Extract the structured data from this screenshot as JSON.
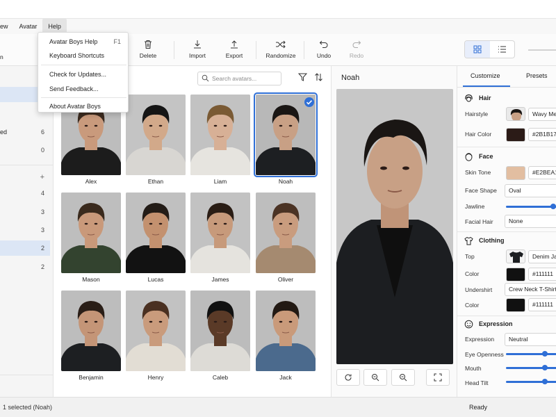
{
  "menubar": {
    "items": [
      {
        "label": "ew"
      },
      {
        "label": "Avatar"
      },
      {
        "label": "Help"
      }
    ]
  },
  "help_menu": {
    "items": [
      {
        "label": "Avatar Boys Help",
        "shortcut": "F1"
      },
      {
        "label": "Keyboard Shortcuts",
        "shortcut": ""
      },
      {
        "label": "Check for Updates...",
        "shortcut": ""
      },
      {
        "label": "Send Feedback...",
        "shortcut": ""
      },
      {
        "label": "About Avatar Boys",
        "shortcut": ""
      }
    ]
  },
  "toolbar": {
    "left_partial": "n",
    "delete": "Delete",
    "import": "Import",
    "export": "Export",
    "randomize": "Randomize",
    "undo": "Undo",
    "redo": "Redo"
  },
  "sidebar": {
    "rows": [
      {
        "label": "",
        "count": ""
      },
      {
        "label": "ed",
        "count": "6"
      },
      {
        "label": "",
        "count": "0"
      },
      {
        "label": "",
        "count": "+"
      },
      {
        "label": "",
        "count": "4"
      },
      {
        "label": "",
        "count": "3"
      },
      {
        "label": "",
        "count": "3"
      },
      {
        "label": "",
        "count": "2"
      },
      {
        "label": "",
        "count": "2"
      }
    ]
  },
  "gallery": {
    "search_placeholder": "Search avatars...",
    "avatars": [
      {
        "name": "Alex",
        "skin": "#c99a7c",
        "hair": "#3b2a1f",
        "top": "#1c1c1c",
        "bg": "#bdbdbd"
      },
      {
        "name": "Ethan",
        "skin": "#d2a98a",
        "hair": "#151515",
        "top": "#d8d6d2",
        "bg": "#c4c4c4"
      },
      {
        "name": "Liam",
        "skin": "#d7b096",
        "hair": "#7a5a34",
        "top": "#e6e4df",
        "bg": "#c2c2c2"
      },
      {
        "name": "Noah",
        "skin": "#c8a085",
        "hair": "#1a1614",
        "top": "#1d1f22",
        "bg": "#b8b8b8"
      },
      {
        "name": "Mason",
        "skin": "#c9997a",
        "hair": "#3a2a1d",
        "top": "#33432f",
        "bg": "#bebebe"
      },
      {
        "name": "Lucas",
        "skin": "#c3916f",
        "hair": "#231c17",
        "top": "#121212",
        "bg": "#c0c0c0"
      },
      {
        "name": "James",
        "skin": "#c79a7b",
        "hair": "#2a1d15",
        "top": "#e5e3de",
        "bg": "#c2c2c2"
      },
      {
        "name": "Oliver",
        "skin": "#c99c7e",
        "hair": "#4b3324",
        "top": "#a58a70",
        "bg": "#bebebe"
      },
      {
        "name": "Benjamin",
        "skin": "#c49577",
        "hair": "#2a1e17",
        "top": "#1d1f22",
        "bg": "#bdbdbd"
      },
      {
        "name": "Henry",
        "skin": "#c99b7c",
        "hair": "#4a3021",
        "top": "#e2ddd4",
        "bg": "#c2c2c2"
      },
      {
        "name": "Caleb",
        "skin": "#5a3a27",
        "hair": "#111111",
        "top": "#dddbd6",
        "bg": "#bcbcbc"
      },
      {
        "name": "Jack",
        "skin": "#c99a7a",
        "hair": "#221913",
        "top": "#4b6a8d",
        "bg": "#bdbdbd"
      }
    ]
  },
  "preview": {
    "title": "Noah"
  },
  "properties": {
    "tabs": [
      "Customize",
      "Presets"
    ],
    "hair": {
      "heading": "Hair",
      "hairstyle_label": "Hairstyle",
      "hairstyle_value": "Wavy Me",
      "color_label": "Hair Color",
      "color_value": "#2B1B17"
    },
    "face": {
      "heading": "Face",
      "skin_label": "Skin Tone",
      "skin_value": "#E2BEA1",
      "shape_label": "Face Shape",
      "shape_value": "Oval",
      "jawline_label": "Jawline",
      "jawline_level": 0.85,
      "facial_hair_label": "Facial Hair",
      "facial_hair_value": "None"
    },
    "clothing": {
      "heading": "Clothing",
      "top_label": "Top",
      "top_value": "Denim Ja",
      "top_color_label": "Color",
      "top_color_value": "#111111",
      "undershirt_label": "Undershirt",
      "undershirt_value": "Crew Neck T-Shirt",
      "under_color_label": "Color",
      "under_color_value": "#111111"
    },
    "expression": {
      "heading": "Expression",
      "expression_label": "Expression",
      "expression_value": "Neutral",
      "eye_label": "Eye Openness",
      "eye_level": 0.7,
      "mouth_label": "Mouth",
      "mouth_level": 0.7,
      "head_tilt_label": "Head Tilt",
      "head_tilt_level": 0.7
    }
  },
  "status": {
    "left": "1 selected (Noah)",
    "right": "Ready"
  },
  "colors": {
    "accent": "#2f6fd6",
    "selection": "#dce6f5",
    "hair_swatch": "#2B1B17",
    "skin_swatch": "#E2BEA1",
    "clothing_swatch": "#111111"
  }
}
